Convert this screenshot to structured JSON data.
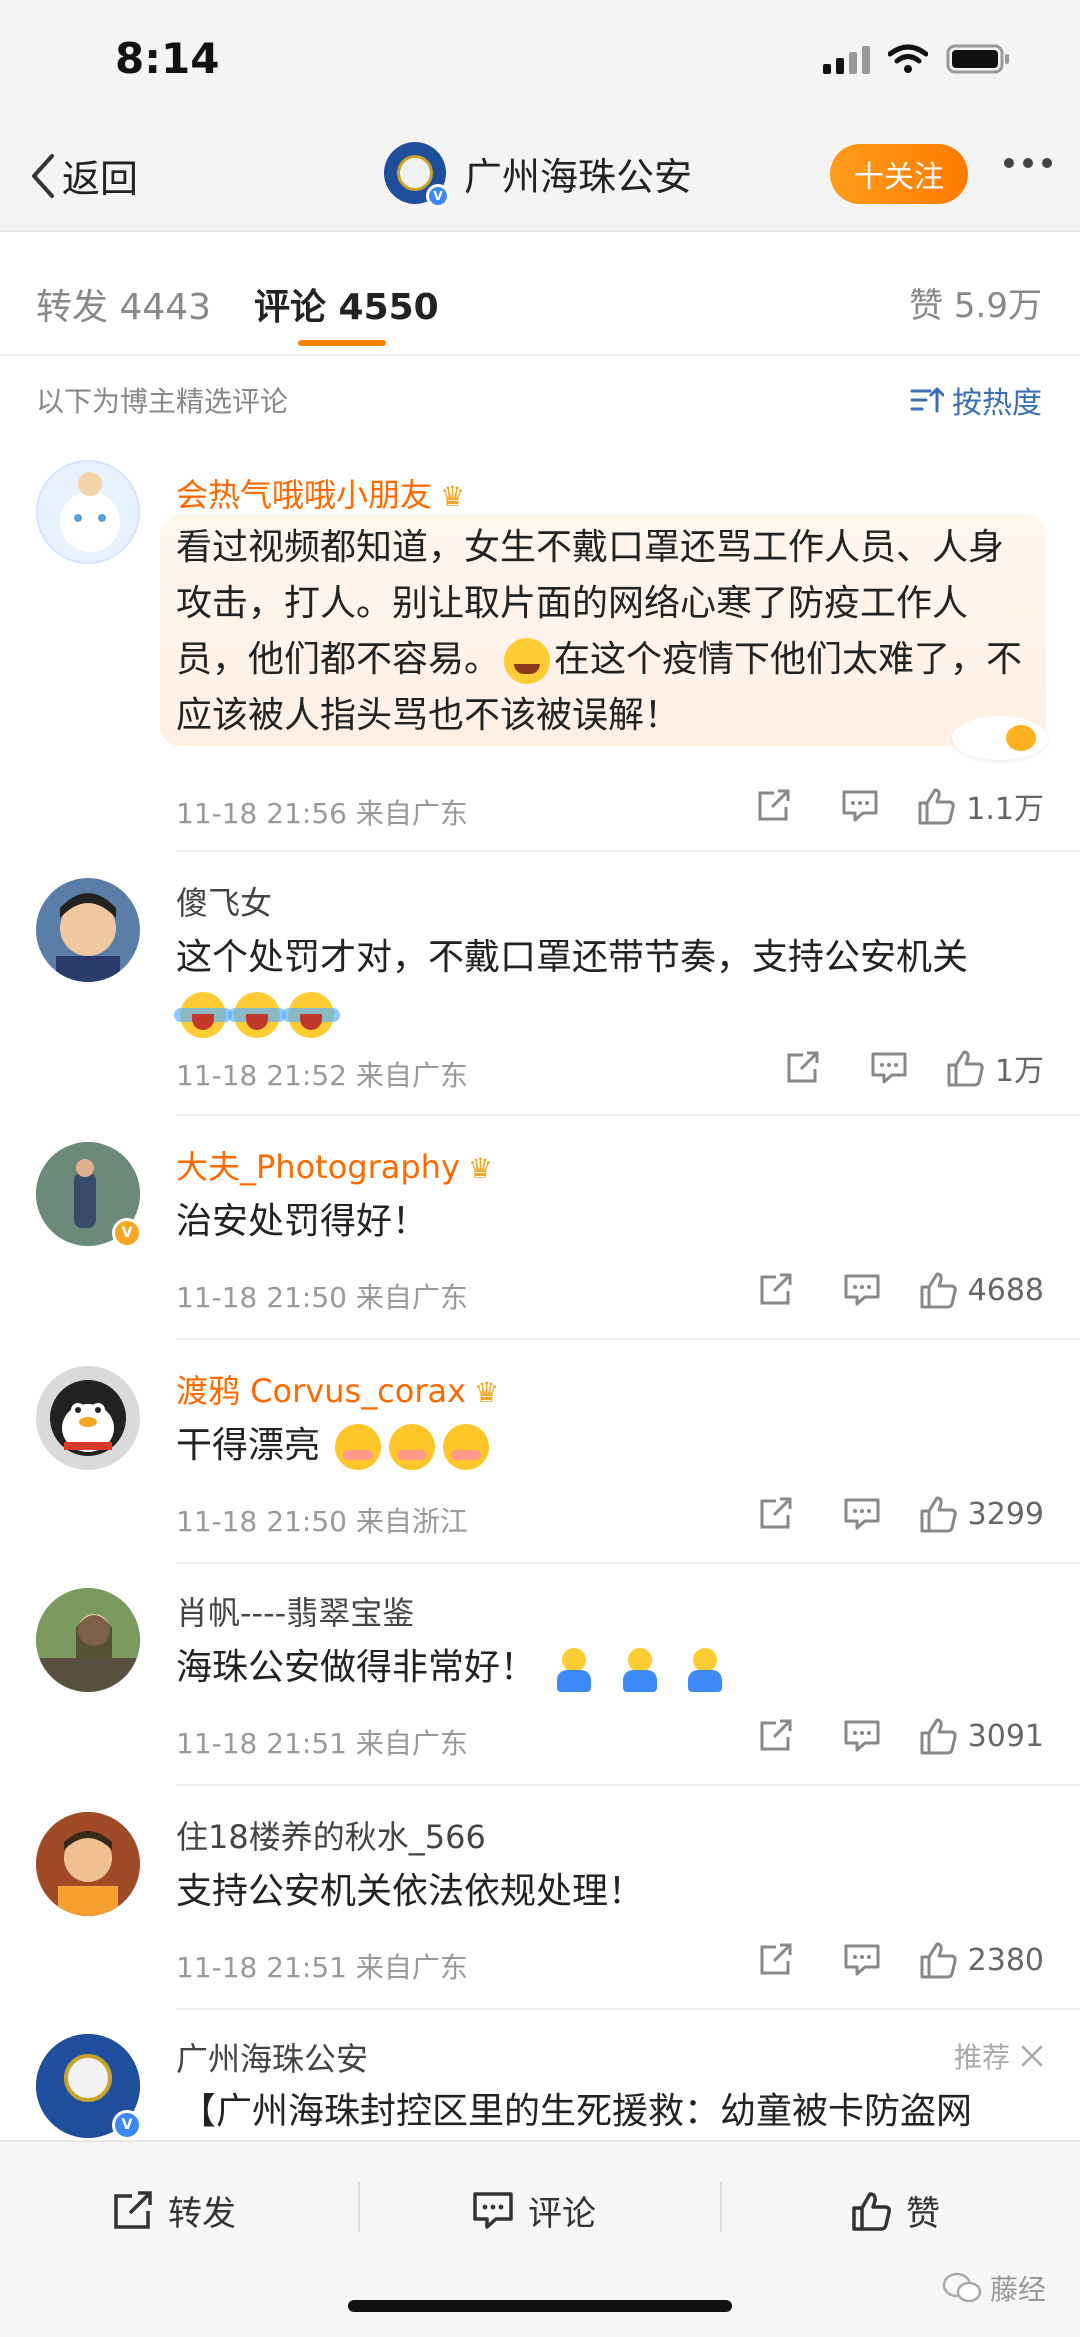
{
  "status": {
    "time": "8:14"
  },
  "nav": {
    "back_label": "返回",
    "account_name": "广州海珠公安",
    "follow_label": "十关注"
  },
  "tabs": {
    "repost": "转发 4443",
    "comment": "评论 4550",
    "like": "赞 5.9万"
  },
  "subheader": {
    "left": "以下为博主精选评论",
    "sort": "按热度"
  },
  "comments": [
    {
      "name": "会热气哦哦小朋友",
      "text": "看过视频都知道，女生不戴口罩还骂工作人员、人身攻击，打人。别让取片面的网络心寒了防疫工作人员，他们都不容易。",
      "text2": "在这个疫情下他们太难了，不应该被人指头骂也不该被误解！",
      "meta": "11-18 21:56  来自广东",
      "likes": "1.1万"
    },
    {
      "name": "傻飞女",
      "text": "这个处罚才对，不戴口罩还带节奏，支持公安机关",
      "meta": "11-18 21:52  来自广东",
      "likes": "1万"
    },
    {
      "name": "大夫_Photography",
      "text": "治安处罚得好！",
      "meta": "11-18 21:50  来自广东",
      "likes": "4688"
    },
    {
      "name": "渡鸦 Corvus_corax",
      "text": "干得漂亮",
      "meta": "11-18 21:50  来自浙江",
      "likes": "3299"
    },
    {
      "name": "肖帆----翡翠宝鉴",
      "text": "海珠公安做得非常好！",
      "meta": "11-18 21:51  来自广东",
      "likes": "3091"
    },
    {
      "name": "住18楼养的秋水_566",
      "text": "支持公安机关依法依规处理！",
      "meta": "11-18 21:51  来自广东",
      "likes": "2380"
    },
    {
      "name": "广州海珠公安",
      "text": "【广州海珠封控区里的生死援救：幼童被卡防盗网",
      "recommend": "推荐"
    }
  ],
  "bottom": {
    "repost": "转发",
    "comment": "评论",
    "like": "赞"
  },
  "watermark": "藤经",
  "colors": {
    "accent": "#ff8200",
    "vip_name": "#ff6a00",
    "link_blue": "#3a6fb7"
  }
}
